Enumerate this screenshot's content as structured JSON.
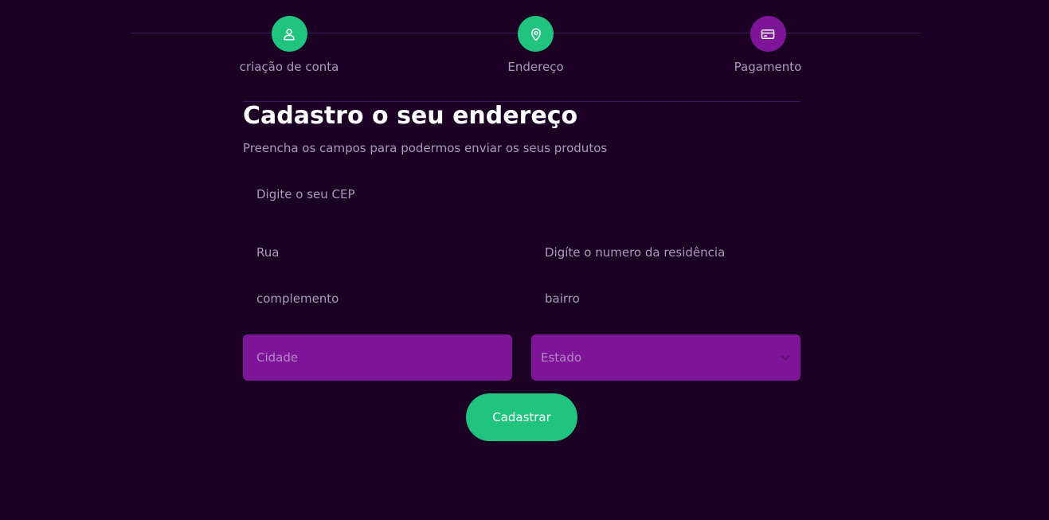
{
  "stepper": {
    "steps": [
      {
        "label": "criação de conta",
        "icon": "user-icon",
        "color": "#21c47f"
      },
      {
        "label": "Endereço",
        "icon": "map-pin-icon",
        "color": "#21c47f"
      },
      {
        "label": "Pagamento",
        "icon": "credit-card-icon",
        "color": "#7e1497"
      }
    ]
  },
  "form": {
    "title": "Cadastro o seu endereço",
    "subtitle": "Preencha os campos para podermos enviar os seus produtos",
    "cep_placeholder": "Digite o seu CEP",
    "street_placeholder": "Rua",
    "number_placeholder": "Digíte o numero da residência",
    "complement_placeholder": "complemento",
    "neighborhood_placeholder": "bairro",
    "city_placeholder": "Cidade",
    "state_selected": "Estado",
    "submit_label": "Cadastrar"
  },
  "colors": {
    "background": "#1b0024",
    "accent_green": "#21c47f",
    "accent_purple": "#7e1497"
  }
}
